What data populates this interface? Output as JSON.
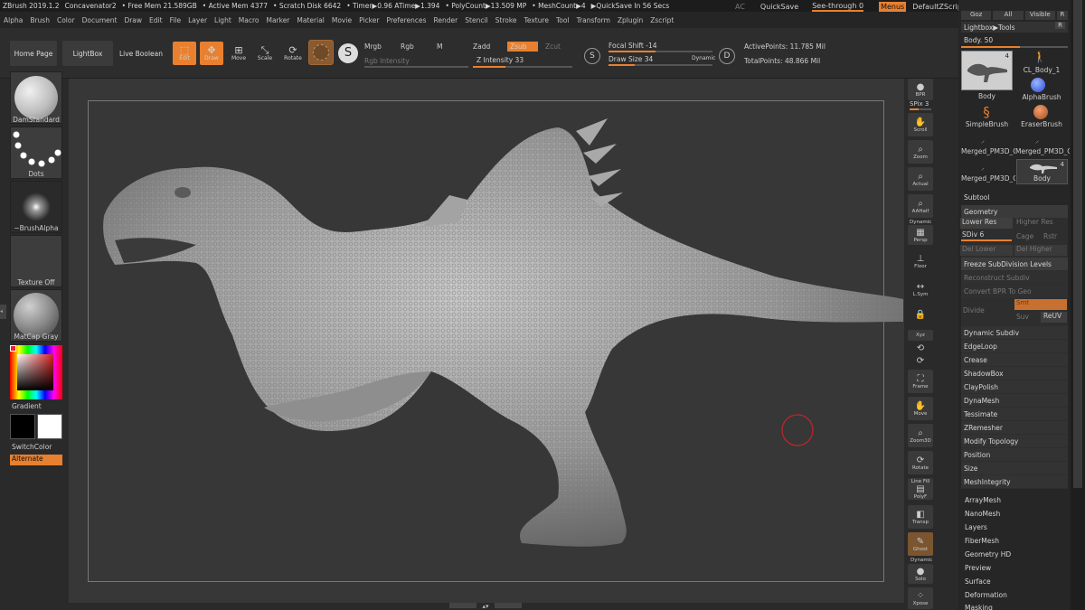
{
  "title_bar": {
    "app": "ZBrush 2019.1.2",
    "document": "Concavenator2",
    "stats": [
      "• Free Mem 21.589GB",
      "• Active Mem 4377",
      "• Scratch Disk 6642",
      "• Timer▶0.96 ATime▶1.394",
      "• PolyCount▶13.509 MP",
      "• MeshCount▶4",
      "▶QuickSave In 56 Secs"
    ],
    "ac": "AC",
    "quicksave": "QuickSave",
    "see_through": "See-through  0",
    "menus": "Menus",
    "script": "DefaultZScript"
  },
  "menubar": [
    "Alpha",
    "Brush",
    "Color",
    "Document",
    "Draw",
    "Edit",
    "File",
    "Layer",
    "Light",
    "Macro",
    "Marker",
    "Material",
    "Movie",
    "Picker",
    "Preferences",
    "Render",
    "Stencil",
    "Stroke",
    "Texture",
    "Tool",
    "Transform",
    "Zplugin",
    "Zscript"
  ],
  "toolbar": {
    "home": "Home Page",
    "lightbox": "LightBox",
    "live_boolean": "Live Boolean",
    "edit": "Edit",
    "draw": "Draw",
    "move": "Move",
    "scale": "Scale",
    "rotate": "Rotate",
    "mrgb": "Mrgb",
    "rgb": "Rgb",
    "m": "M",
    "zadd": "Zadd",
    "zsub": "Zsub",
    "zcut": "Zcut",
    "rgb_intensity": "Rgb Intensity",
    "z_intensity": "Z Intensity 33",
    "z_intensity_value": 0.33,
    "focal_shift": "Focal Shift -14",
    "draw_size": "Draw Size 34",
    "dynamic": "Dynamic",
    "active_points": "ActivePoints: 11.785 Mil",
    "total_points": "TotalPoints: 48.866 Mil",
    "s_key": "S",
    "d_key": "D"
  },
  "left_shelf": {
    "brush": "DamStandard",
    "stroke": "Dots",
    "alpha": "~BrushAlpha",
    "texture": "Texture Off",
    "material": "MatCap Gray",
    "gradient": "Gradient",
    "switch_color": "SwitchColor",
    "alternate": "Alternate"
  },
  "right_shelf": [
    "BPR",
    "SPix 3",
    "Scroll",
    "Zoom",
    "Actual",
    "AAHalf",
    "Dynamic",
    "Persp",
    "Floor",
    "L.Sym",
    "",
    "Xyz",
    "",
    "",
    "Frame",
    "Move",
    "Zoom3D",
    "Rotate",
    "Line Fill",
    "PolyF",
    "Transp",
    "Ghost",
    "Dynamic",
    "Solo",
    "Xpose"
  ],
  "tool_panel": {
    "top_buttons": [
      "Goz",
      "All",
      "Visible",
      "R"
    ],
    "lightbox_tools": "Lightbox▶Tools",
    "body_slider": "Body. 50",
    "tools": [
      "Body",
      "CL_Body_1",
      "AlphaBrush",
      "SimpleBrush",
      "EraserBrush",
      "Merged_PM3D_C",
      "Merged_PM3D_C",
      "Merged_PM3D_C",
      "Body"
    ],
    "badge_4": "4",
    "subtool": "Subtool",
    "geometry": "Geometry",
    "lower_res": "Lower Res",
    "higher_res": "Higher Res",
    "sdiv": "SDiv 6",
    "cage": "Cage",
    "rstr": "Rstr",
    "del_lower": "Del Lower",
    "del_higher": "Del Higher",
    "freeze": "Freeze SubDivision Levels",
    "reconstruct": "Reconstruct Subdiv",
    "convert_bpr": "Convert BPR To Geo",
    "divide": "Divide",
    "smt": "Smt",
    "suv": "Suv",
    "reuv": "ReUV",
    "items": [
      "Dynamic Subdiv",
      "EdgeLoop",
      "Crease",
      "ShadowBox",
      "ClayPolish",
      "DynaMesh",
      "Tessimate",
      "ZRemesher",
      "Modify Topology",
      "Position",
      "Size",
      "MeshIntegrity"
    ],
    "sections": [
      "ArrayMesh",
      "NanoMesh",
      "Layers",
      "FiberMesh",
      "Geometry HD",
      "Preview",
      "Surface",
      "Deformation",
      "Masking"
    ]
  },
  "colors": {
    "accent": "#e8802f",
    "panel": "#262626",
    "canvas": "#373737",
    "cursor": "#c0262b"
  }
}
